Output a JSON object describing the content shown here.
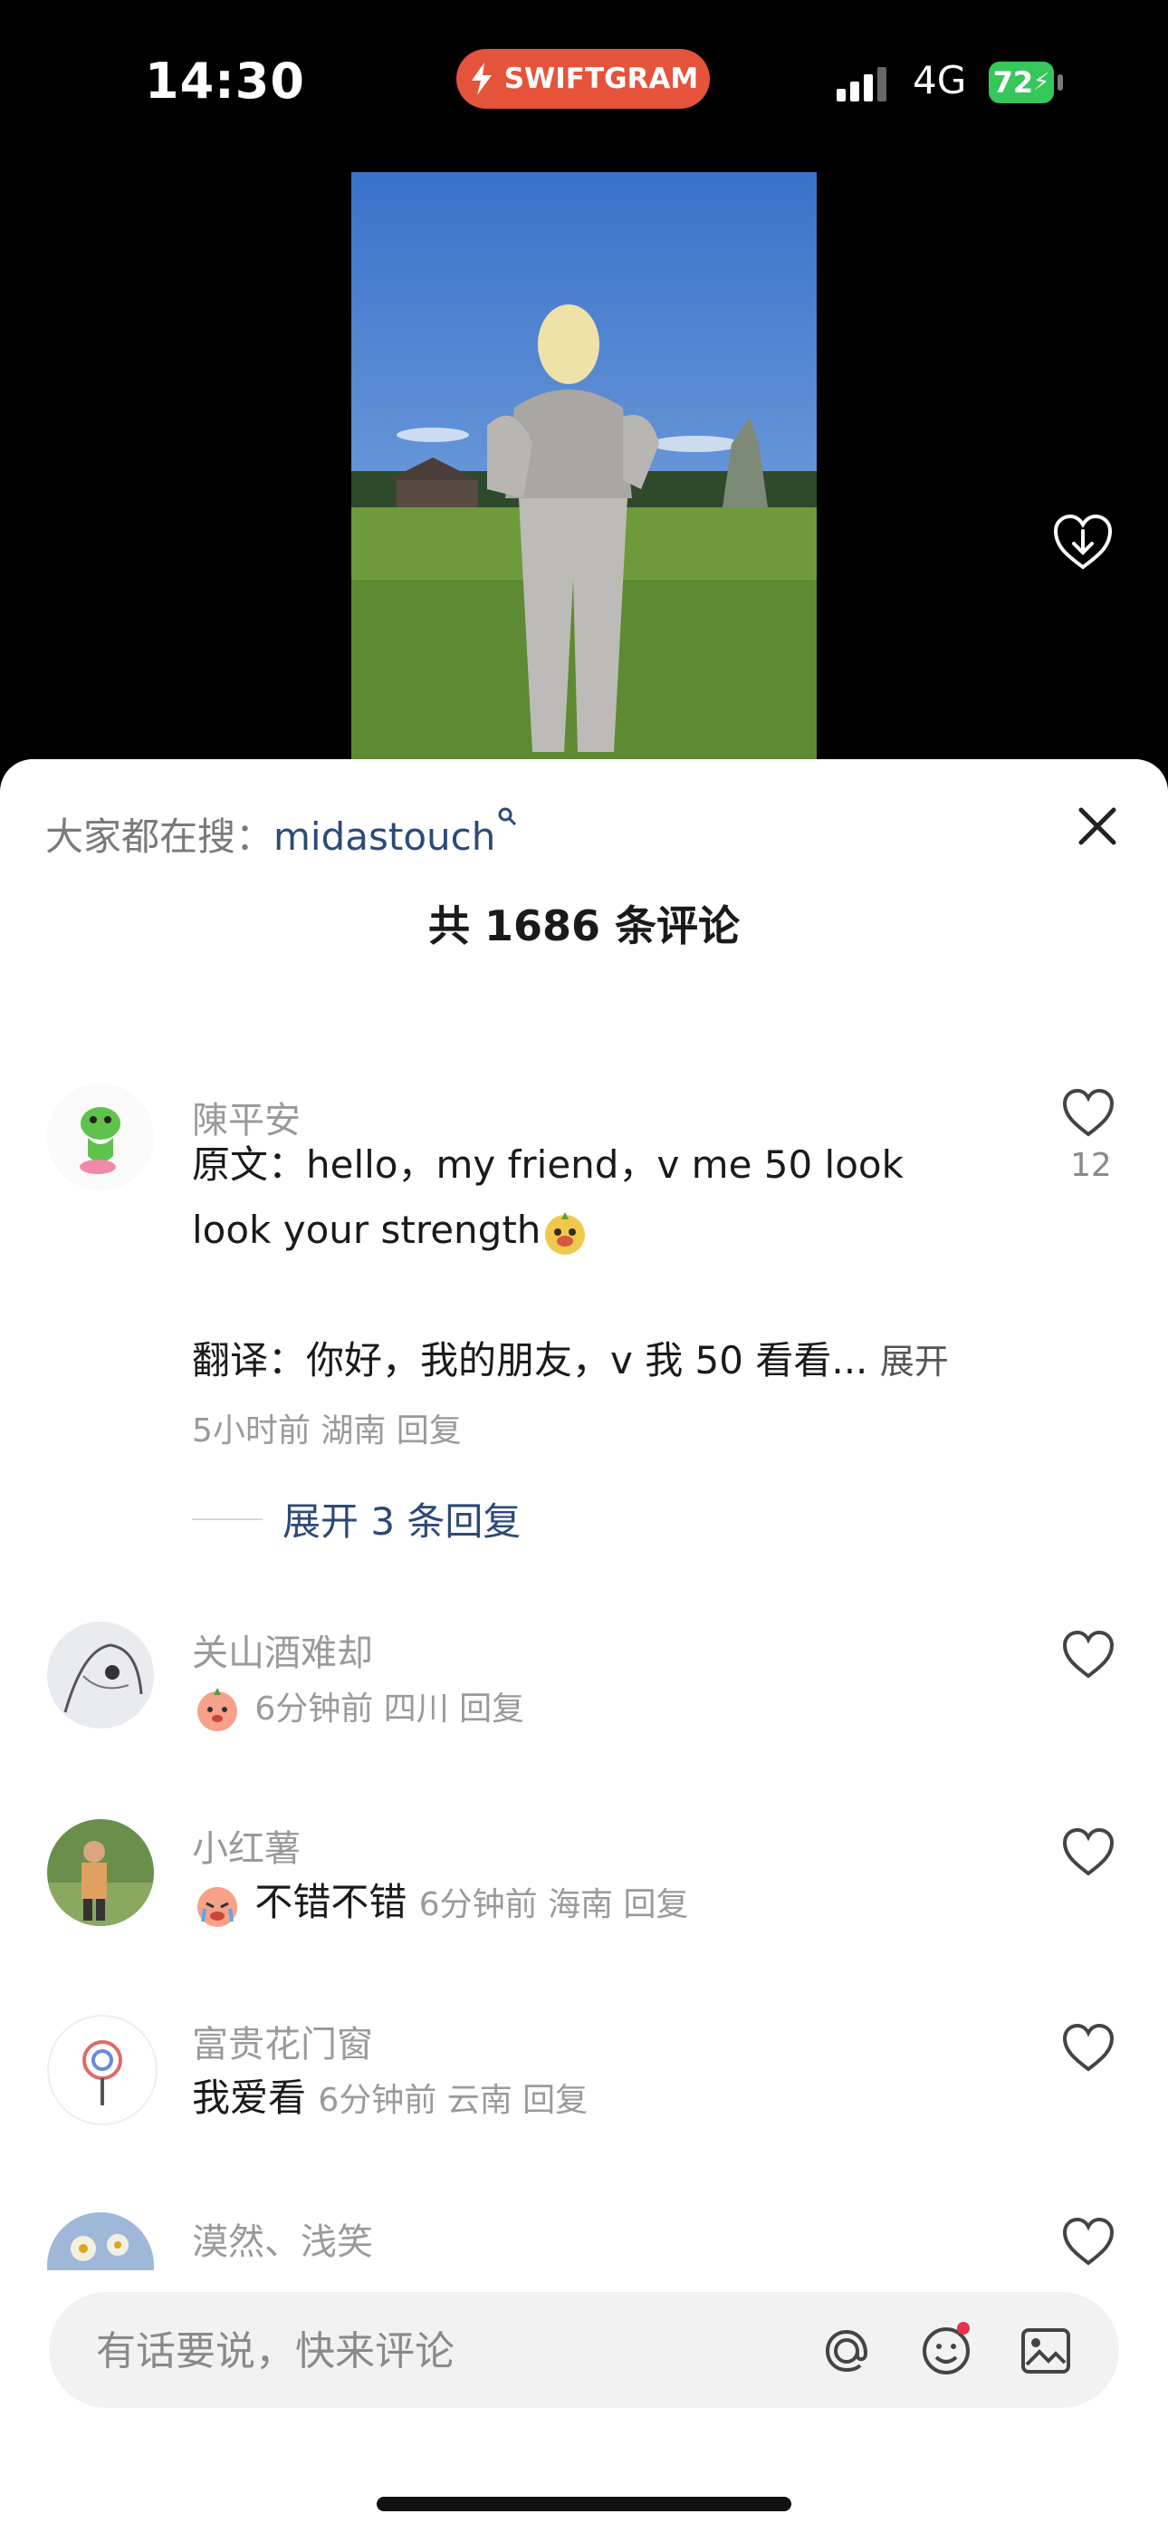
{
  "status_bar": {
    "time": "14:30",
    "badge": "SWIFTGRAM",
    "network": "4G",
    "battery": "72"
  },
  "sheet": {
    "trending_prefix": "大家都在搜：",
    "trending_keyword": "midastouch",
    "comment_count_title": "共 1686 条评论",
    "comments": [
      {
        "name": "陳平安",
        "text_line1": "原文：hello，my friend，v me 50 look",
        "text_line2": "look your strength",
        "text_line3": "翻译：你好，我的朋友，v 我 50 看看...",
        "expand_label": "展开",
        "meta": "5小时前 湖南 回复",
        "likes": "12",
        "replies_label": "展开 3 条回复"
      },
      {
        "name": "关山酒难却",
        "text": "",
        "meta": "6分钟前 四川 回复"
      },
      {
        "name": "小红薯",
        "text": "不错不错",
        "meta": "6分钟前 海南 回复"
      },
      {
        "name": "富贵花门窗",
        "text": "我爱看",
        "meta": "6分钟前 云南 回复"
      },
      {
        "name": "漠然、浅笑"
      }
    ]
  },
  "input_bar": {
    "placeholder": "有话要说，快来评论"
  },
  "colors": {
    "accent_link": "#2c4a78",
    "badge": "#e5533b",
    "battery": "#35c759",
    "notification_dot": "#e8324a"
  }
}
